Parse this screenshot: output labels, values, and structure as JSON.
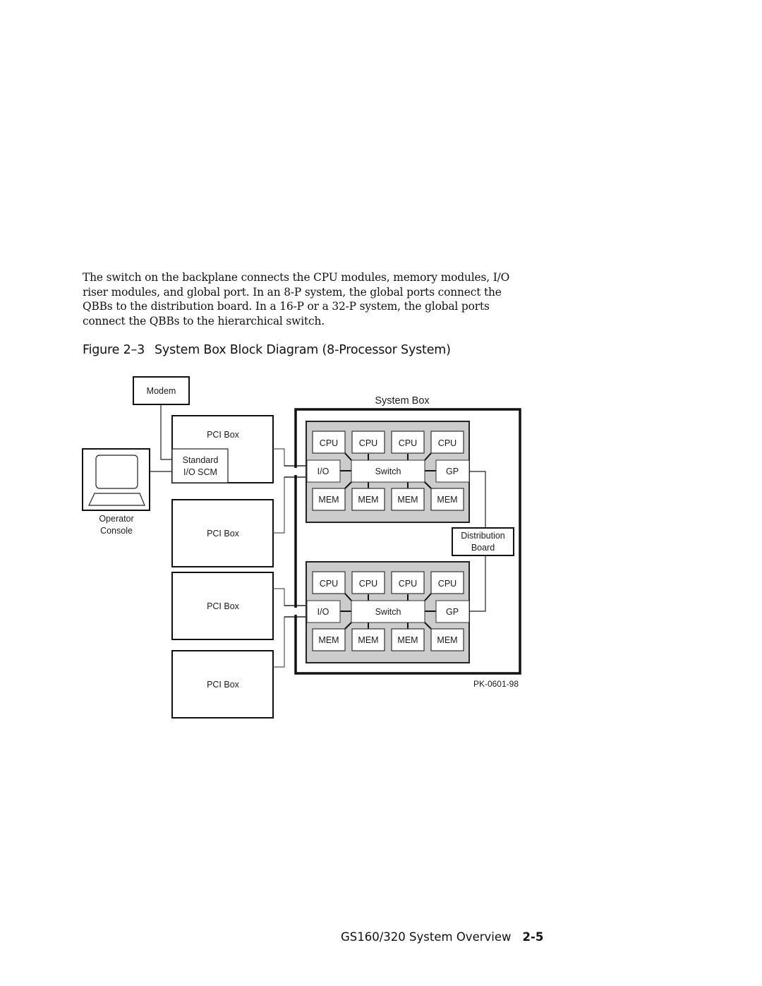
{
  "body_text": {
    "lines": [
      "The switch on the backplane connects the CPU modules, memory modules,  I/O",
      "riser modules, and global port.  In an 8-P system, the global ports connect the",
      "QBBs to the distribution board.  In a 16-P or a 32-P system, the global ports",
      "connect the QBBs to the hierarchical switch."
    ]
  },
  "figure": {
    "number": "Figure 2–3",
    "title": "System Box Block Diagram (8-Processor System)",
    "labels": {
      "modem": "Modem",
      "operator_console": [
        "Operator",
        "Console"
      ],
      "pci_box": "PCI Box",
      "standard_io_scm": [
        "Standard",
        "I/O SCM"
      ],
      "system_box": "System Box",
      "cpu": "CPU",
      "mem": "MEM",
      "io": "I/O",
      "switch": "Switch",
      "gp": "GP",
      "distribution_board": [
        "Distribution",
        "Board"
      ],
      "figure_id": "PK-0601-98"
    },
    "qbb_count": 2,
    "cpus_per_qbb": 4,
    "mems_per_qbb": 4,
    "pci_box_count": 4,
    "colors": {
      "qbb_fill": "#cccccc",
      "line": "#111111",
      "connector_line": "#555555"
    }
  },
  "footer": {
    "section": "GS160/320 System Overview",
    "page": "2-5"
  }
}
